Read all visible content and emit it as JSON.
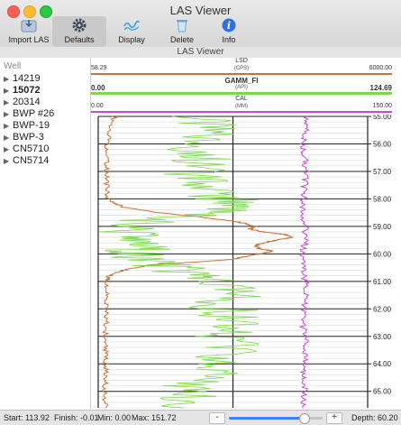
{
  "window": {
    "title": "LAS Viewer",
    "subtitle": "LAS Viewer"
  },
  "toolbar": {
    "import_label": "Import LAS",
    "defaults_label": "Defaults",
    "display_label": "Display",
    "delete_label": "Delete",
    "info_label": "Info"
  },
  "sidebar": {
    "header": "Well",
    "wells": [
      {
        "label": "14219",
        "bold": false
      },
      {
        "label": "15072",
        "bold": true
      },
      {
        "label": "20314",
        "bold": false
      },
      {
        "label": "BWP #26",
        "bold": false
      },
      {
        "label": "BWP-19",
        "bold": false
      },
      {
        "label": "BWP-3",
        "bold": false
      },
      {
        "label": "CN5710",
        "bold": false
      },
      {
        "label": "CN5714",
        "bold": false
      }
    ]
  },
  "tracks": [
    {
      "name": "LSD",
      "unit": "(CPS)",
      "min": "58.29",
      "max": "6000.00",
      "color": "#c8713a"
    },
    {
      "name": "GAMM_FI",
      "unit": "(API)",
      "min": "0.00",
      "max": "124.69",
      "color": "#7cd84a"
    },
    {
      "name": "CAL",
      "unit": "(MM)",
      "min": "0.00",
      "max": "150.00",
      "color": "#c64bd8"
    }
  ],
  "chart_data": {
    "type": "line",
    "ylabel": "Depth",
    "y_ticks": [
      "55.00",
      "56.00",
      "57.00",
      "58.00",
      "59.00",
      "60.00",
      "61.00",
      "62.00",
      "63.00",
      "64.00",
      "65.00"
    ],
    "ylim": [
      55.0,
      65.6
    ],
    "series": [
      {
        "name": "LSD",
        "color": "#c8713a",
        "depth": [
          55.0,
          55.5,
          56.0,
          56.5,
          57.0,
          57.5,
          58.0,
          58.3,
          58.5,
          58.7,
          58.8,
          58.9,
          59.0,
          59.1,
          59.2,
          59.3,
          59.4,
          59.5,
          59.6,
          59.7,
          59.8,
          59.9,
          60.0,
          60.1,
          60.2,
          60.3,
          60.4,
          60.6,
          60.8,
          61.0,
          61.5,
          62.0,
          62.5,
          63.0,
          63.5,
          64.0,
          64.5,
          65.0,
          65.6
        ],
        "value": [
          420,
          300,
          260,
          250,
          240,
          250,
          260,
          600,
          1400,
          2500,
          3000,
          3300,
          3500,
          3400,
          3700,
          4200,
          4300,
          4000,
          3700,
          3500,
          3600,
          3900,
          3600,
          3300,
          3000,
          2200,
          1200,
          600,
          300,
          250,
          230,
          240,
          230,
          220,
          220,
          230,
          220,
          210,
          220
        ]
      },
      {
        "name": "GAMM_FI",
        "color": "#7cd84a",
        "depth": [
          55.0,
          55.5,
          56.0,
          56.5,
          57.0,
          57.5,
          58.0,
          58.3,
          58.6,
          58.9,
          59.2,
          59.5,
          59.8,
          60.1,
          60.4,
          60.7,
          61.0,
          61.5,
          62.0,
          62.5,
          63.0,
          63.5,
          64.0,
          64.5,
          65.0,
          65.6
        ],
        "value": [
          45,
          50,
          46,
          48,
          44,
          52,
          58,
          70,
          40,
          15,
          12,
          18,
          20,
          14,
          30,
          40,
          55,
          60,
          58,
          62,
          56,
          60,
          52,
          48,
          42,
          40
        ]
      },
      {
        "name": "CAL",
        "color": "#c64bd8",
        "depth": [
          55.0,
          55.5,
          56.0,
          56.5,
          57.0,
          57.5,
          58.0,
          58.5,
          59.0,
          59.5,
          60.0,
          60.5,
          61.0,
          61.5,
          62.0,
          62.5,
          63.0,
          63.5,
          64.0,
          64.5,
          65.0,
          65.6
        ],
        "value": [
          115,
          116,
          114,
          115,
          116,
          115,
          114,
          113,
          115,
          116,
          113,
          114,
          115,
          116,
          115,
          114,
          115,
          116,
          115,
          114,
          115,
          114
        ]
      }
    ]
  },
  "status": {
    "start_label": "Start:",
    "start": "113.92",
    "finish_label": "Finish:",
    "finish": "-0.01",
    "min_label": "Min:",
    "min": "0.00",
    "max_label": "Max:",
    "max": "151.72",
    "minus": "-",
    "plus": "+",
    "depth_label": "Depth:",
    "depth": "60.20",
    "slider_value": 0.8
  }
}
